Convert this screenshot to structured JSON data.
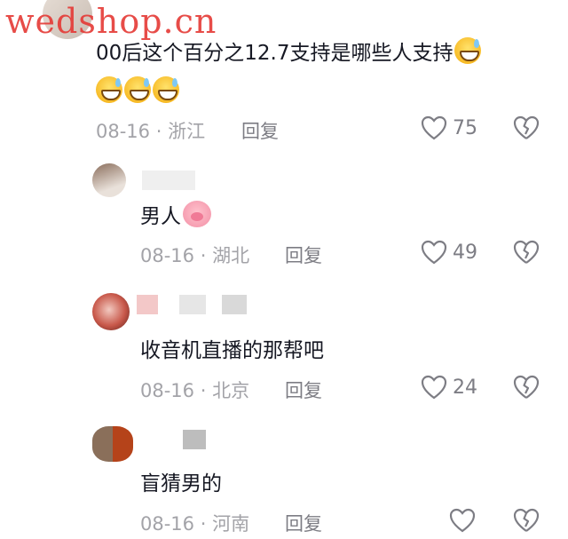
{
  "watermark": "wedshop.cn",
  "comments": [
    {
      "text": "00后这个百分之12.7支持是哪些人支持",
      "date": "08-16",
      "separator": "·",
      "location": "浙江",
      "reply_label": "回复",
      "likes": "75",
      "emojis": [
        "grinning-sweat-emoji",
        "grinning-sweat-emoji",
        "grinning-sweat-emoji",
        "grinning-sweat-emoji"
      ]
    },
    {
      "text": "男人",
      "date": "08-16",
      "separator": "·",
      "location": "湖北",
      "reply_label": "回复",
      "likes": "49",
      "emojis": [
        "pig-face-emoji"
      ]
    },
    {
      "text": "收音机直播的那帮吧",
      "date": "08-16",
      "separator": "·",
      "location": "北京",
      "reply_label": "回复",
      "likes": "24"
    },
    {
      "text": "盲猜男的",
      "date": "08-16",
      "separator": "·",
      "location": "河南",
      "reply_label": "回复",
      "likes": ""
    }
  ],
  "colors": {
    "text": "#161823",
    "meta": "#a3a3a8",
    "icon": "#7d7d84",
    "watermark": "#e53935"
  }
}
